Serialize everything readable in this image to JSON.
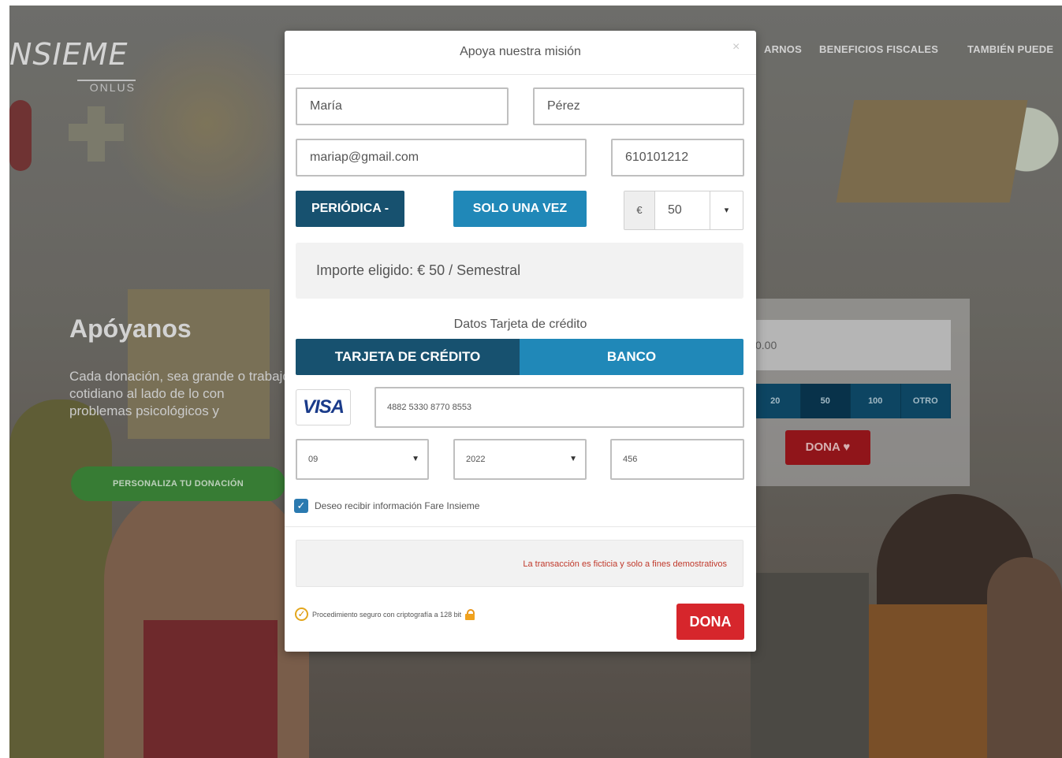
{
  "background": {
    "logo": "NSIEME",
    "logo_sub": "ONLUS",
    "nav": [
      "ARNOS",
      "BENEFICIOS FISCALES",
      "TAMBIÉN PUEDE"
    ],
    "hero": {
      "title": "Apóyanos",
      "text": "Cada donación, sea grande o trabajo cotidiano al lado de lo con problemas psicológicos y",
      "button": "PERSONALIZA TU DONACIÓN"
    },
    "widget": {
      "input_value": "0.00",
      "amounts": [
        "20",
        "50",
        "100",
        "OTRO"
      ],
      "donate": "DONA ♥"
    }
  },
  "modal": {
    "title": "Apoya nuestra misión",
    "close": "×",
    "first_name": "María",
    "last_name": "Pérez",
    "email": "mariap@gmail.com",
    "phone": "610101212",
    "periodic_button": "PERIÓDICA -",
    "once_button": "SOLO UNA VEZ",
    "currency_symbol": "€",
    "amount": "50",
    "caret": "▾",
    "summary": "Importe eligido: € 50 / Semestral",
    "card_section_label": "Datos Tarjeta de crédito",
    "tabs": [
      "TARJETA DE CRÉDITO",
      "BANCO"
    ],
    "card_brand": "VISA",
    "card_number": "4882 5330 8770 8553",
    "exp_month": "09",
    "exp_year": "2022",
    "cvv": "456",
    "newsletter_label": "Deseo recibir información Fare Insieme",
    "notice": "La transacción es ficticia y solo a fines demostrativos",
    "secure_label": "Procedimiento seguro con criptografía a 128 bit",
    "donate_button": "DONA"
  },
  "colors": {
    "primary_dark": "#17516f",
    "primary_blue": "#2088b8",
    "danger": "#d6262c",
    "notice_text": "#c0392b"
  }
}
